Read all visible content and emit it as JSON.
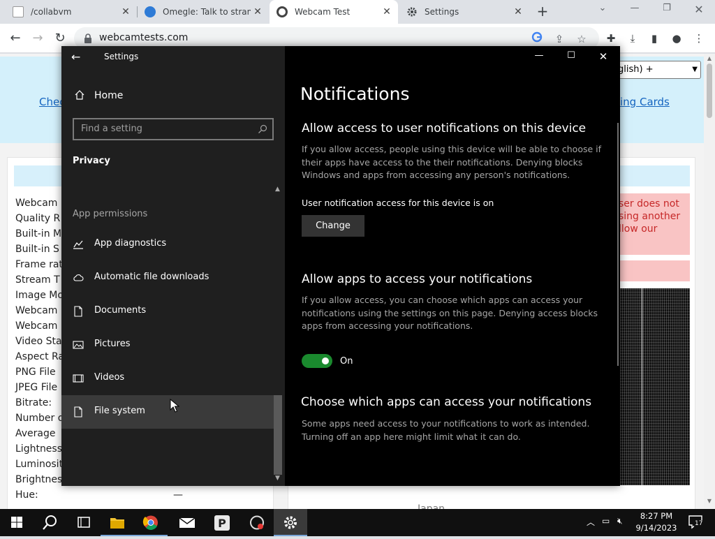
{
  "browser": {
    "tabs": [
      {
        "label": "/collabvm",
        "active": false
      },
      {
        "label": "Omegle: Talk to strangers",
        "active": false
      },
      {
        "label": "Webcam Test",
        "active": true
      },
      {
        "label": "Settings",
        "active": false
      }
    ],
    "url": "webcamtests.com",
    "window_controls": {
      "minimize": "—",
      "restore": "❐",
      "close": "✕"
    },
    "nav": {
      "back": "←",
      "forward": "→",
      "reload": "↻"
    }
  },
  "webpage": {
    "links": {
      "left": "Chec",
      "right": "ing Cards"
    },
    "language_select": "glish) +",
    "row_labels": [
      "Webcam",
      "Quality R",
      "Built-in M",
      "Built-in S",
      "Frame rat",
      "Stream T",
      "Image Mo",
      "Webcam",
      "Webcam",
      "Video Sta",
      "Aspect Ra",
      "PNG File",
      "JPEG File",
      "Bitrate:",
      "Number o",
      "Average",
      "Lightness",
      "Luminosit",
      "Brightnes",
      "Hue:"
    ],
    "hue_value": "—",
    "warning_text": "ser does not\nsing another\nllow our",
    "bottom_label": "Japan"
  },
  "settings": {
    "window_title": "Settings",
    "home_label": "Home",
    "search_placeholder": "Find a setting",
    "category": "Privacy",
    "section": "App permissions",
    "nav_items": [
      {
        "label": "App diagnostics",
        "icon": "app-diagnostics-icon"
      },
      {
        "label": "Automatic file downloads",
        "icon": "cloud-icon"
      },
      {
        "label": "Documents",
        "icon": "document-icon"
      },
      {
        "label": "Pictures",
        "icon": "picture-icon"
      },
      {
        "label": "Videos",
        "icon": "video-icon"
      },
      {
        "label": "File system",
        "icon": "file-icon"
      }
    ],
    "page_title": "Notifications",
    "section1": {
      "heading": "Allow access to user notifications on this device",
      "body": "If you allow access, people using this device will be able to choose if their apps have access to the their notifications. Denying blocks Windows and apps from accessing any person's notifications.",
      "status": "User notification access for this device is on",
      "button": "Change"
    },
    "section2": {
      "heading": "Allow apps to access your notifications",
      "body": "If you allow access, you can choose which apps can access your notifications using the settings on this page. Denying access blocks apps from accessing your notifications.",
      "toggle_label": "On"
    },
    "section3": {
      "heading": "Choose which apps can access your notifications",
      "body": "Some apps need access to your notifications to work as intended. Turning off an app here might limit what it can do."
    }
  },
  "taskbar": {
    "time": "8:27 PM",
    "date": "9/14/2023",
    "notification_count": "17"
  },
  "colors": {
    "toggle_on": "#1a8a2e",
    "settings_left": "#1f1f1f",
    "settings_right": "#000000",
    "taskbar": "#101010"
  }
}
